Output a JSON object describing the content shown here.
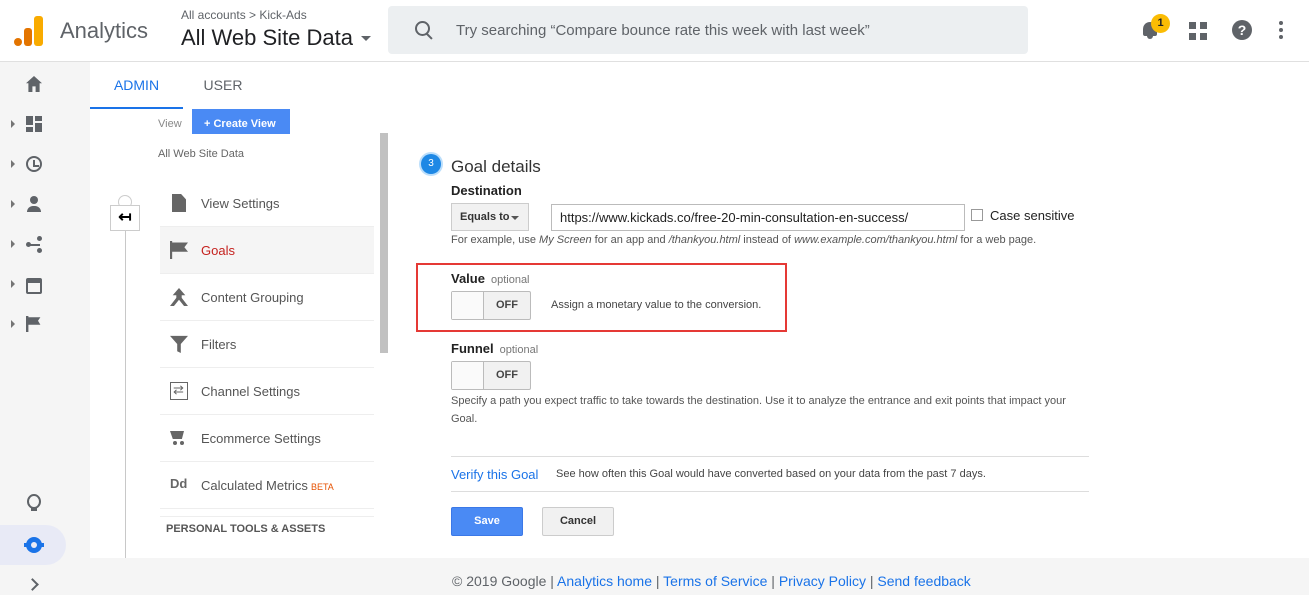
{
  "header": {
    "app_name": "Analytics",
    "account_path": "All accounts > Kick-Ads",
    "property_name": "All Web Site Data",
    "search_placeholder": "Try searching “Compare bounce rate this week with last week”",
    "notification_count": "1",
    "help_glyph": "?"
  },
  "tabs": [
    {
      "label": "ADMIN",
      "active": true
    },
    {
      "label": "USER",
      "active": false
    }
  ],
  "view_column": {
    "view_label": "View",
    "create_view_label": "+ Create View",
    "view_name": "All Web Site Data",
    "back_glyph": "↤",
    "items": [
      {
        "label": "View Settings",
        "icon": "document-icon"
      },
      {
        "label": "Goals",
        "icon": "flag-icon",
        "active": true
      },
      {
        "label": "Content Grouping",
        "icon": "content-grouping-icon"
      },
      {
        "label": "Filters",
        "icon": "filter-icon"
      },
      {
        "label": "Channel Settings",
        "icon": "channel-settings-icon"
      },
      {
        "label": "Ecommerce Settings",
        "icon": "cart-icon"
      },
      {
        "label": "Calculated Metrics",
        "icon": "dd-icon",
        "badge": "BETA"
      }
    ],
    "icon_text_dd": "Dd",
    "section_heading": "PERSONAL TOOLS & ASSETS"
  },
  "goal": {
    "step_number": "3",
    "title": "Goal details",
    "destination_label": "Destination",
    "match_type": "Equals to",
    "destination_value": "https://www.kickads.co/free-20-min-consultation-en-success/",
    "case_sensitive_label": "Case sensitive",
    "destination_help": {
      "p1": "For example, use ",
      "e1": "My Screen",
      "p2": " for an app and ",
      "e2": "/thankyou.html",
      "p3": " instead of ",
      "e3": "www.example.com/thankyou.html",
      "p4": " for a web page."
    },
    "value_label": "Value",
    "optional_label": "optional",
    "value_toggle": "OFF",
    "value_help": "Assign a monetary value to the conversion.",
    "funnel_label": "Funnel",
    "funnel_toggle": "OFF",
    "funnel_help": "Specify a path you expect traffic to take towards the destination. Use it to analyze the entrance and exit points that impact your Goal.",
    "verify_link": "Verify this Goal",
    "verify_help": "See how often this Goal would have converted based on your data from the past 7 days.",
    "save_label": "Save",
    "cancel_label": "Cancel"
  },
  "footer": {
    "copyright": "© 2019 Google",
    "sep": " | ",
    "links": [
      "Analytics home",
      "Terms of Service",
      "Privacy Policy",
      "Send feedback"
    ]
  },
  "colors": {
    "accent": "#1a73e8",
    "highlight_border": "#e53935",
    "badge": "#fbbc04",
    "active_nav_text": "#c5221f"
  }
}
